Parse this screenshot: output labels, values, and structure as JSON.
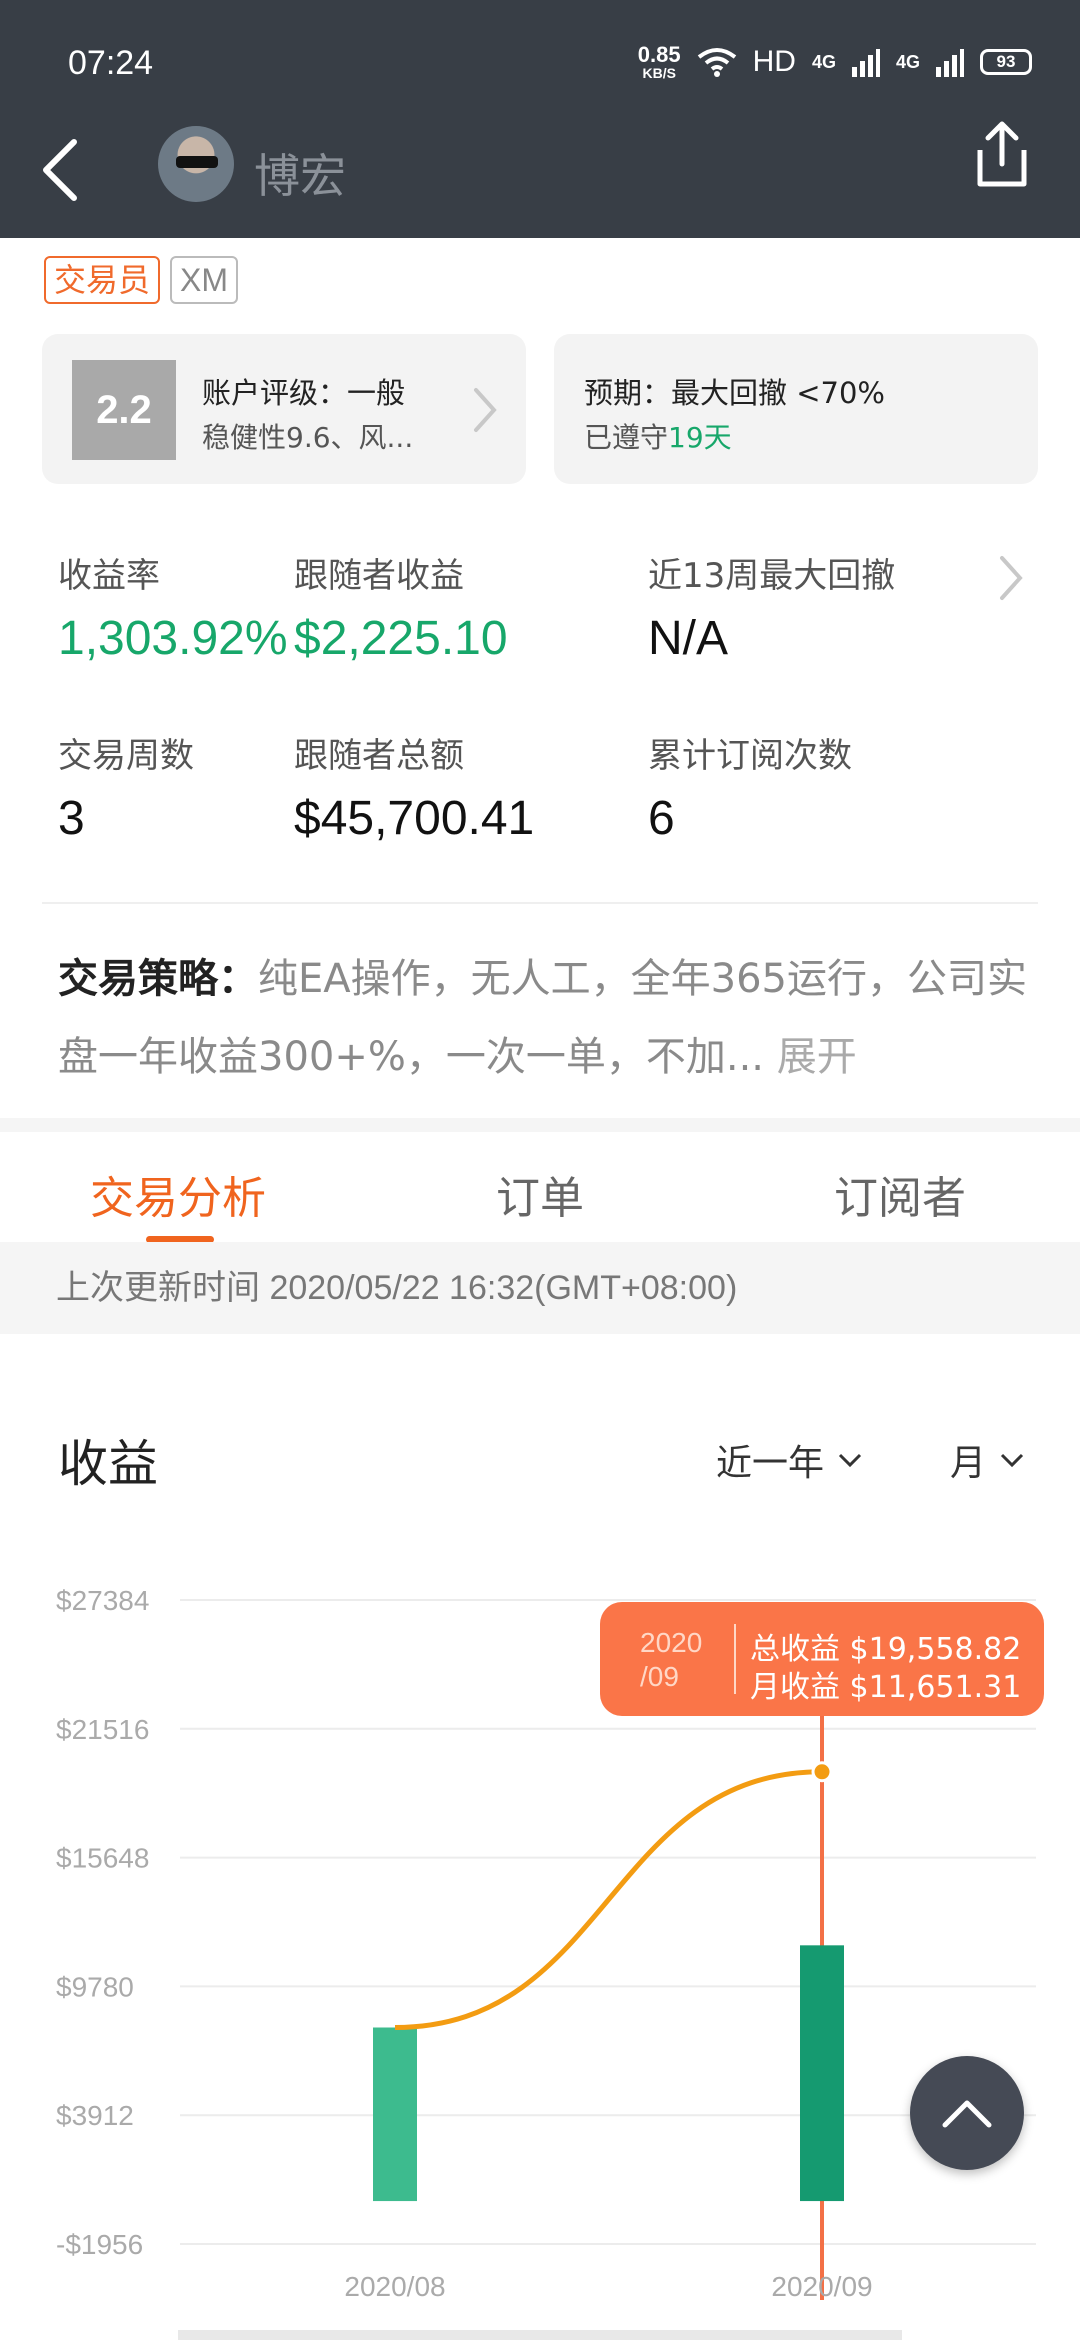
{
  "status_bar": {
    "time": "07:24",
    "net_speed": "0.85",
    "net_unit": "KB/S",
    "hd": "HD",
    "signal1": "4G",
    "signal2": "4G",
    "battery": "93"
  },
  "header": {
    "trader_name": "博宏"
  },
  "tags": {
    "trader": "交易员",
    "broker": "XM"
  },
  "rating_card": {
    "score": "2.2",
    "title": "账户评级：一般",
    "subtitle": "稳健性9.6、风..."
  },
  "expect_card": {
    "title": "预期：最大回撤 <70%",
    "sub_prefix": "已遵守",
    "sub_days": "19天"
  },
  "stats": {
    "return_rate_label": "收益率",
    "return_rate_value": "1,303.92%",
    "follower_profit_label": "跟随者收益",
    "follower_profit_value": "$2,225.10",
    "max_drawdown_label": "近13周最大回撤",
    "max_drawdown_value": "N/A",
    "trade_weeks_label": "交易周数",
    "trade_weeks_value": "3",
    "follower_total_label": "跟随者总额",
    "follower_total_value": "$45,700.41",
    "subscriptions_label": "累计订阅次数",
    "subscriptions_value": "6"
  },
  "strategy": {
    "label": "交易策略：",
    "text": "纯EA操作，无人工，全年365运行，公司实盘一年收益300+%，一次一单，不加...",
    "expand": "展开"
  },
  "tabs": [
    {
      "label": "交易分析",
      "active": true
    },
    {
      "label": "订单",
      "active": false
    },
    {
      "label": "订阅者",
      "active": false
    }
  ],
  "update_time": "上次更新时间 2020/05/22 16:32(GMT+08:00)",
  "chart_section": {
    "title": "收益",
    "range": "近一年",
    "period": "月"
  },
  "tooltip": {
    "date_line1": "2020",
    "date_line2": "/09",
    "total_line": "总收益 $19,558.82",
    "monthly_line": "月收益 $11,651.31"
  },
  "colors": {
    "accent_orange": "#f0641e",
    "profit_green": "#17a76a",
    "bar_light": "#3dbb8e",
    "bar_dark": "#159a70",
    "line": "#f39c12",
    "tooltip_bg": "#fa7548",
    "header_bg": "#383e46"
  },
  "chart_data": {
    "type": "bar",
    "categories": [
      "2020/08",
      "2020/09"
    ],
    "y_ticks": [
      "$27384",
      "$21516",
      "$15648",
      "$9780",
      "$3912",
      "-$1956"
    ],
    "ylim": [
      -1956,
      27384
    ],
    "series": [
      {
        "name": "月收益",
        "type": "bar",
        "values": [
          7907.51,
          11651.31
        ]
      },
      {
        "name": "总收益",
        "type": "line",
        "values": [
          7907.51,
          19558.82
        ]
      }
    ],
    "selected_index": 1
  }
}
